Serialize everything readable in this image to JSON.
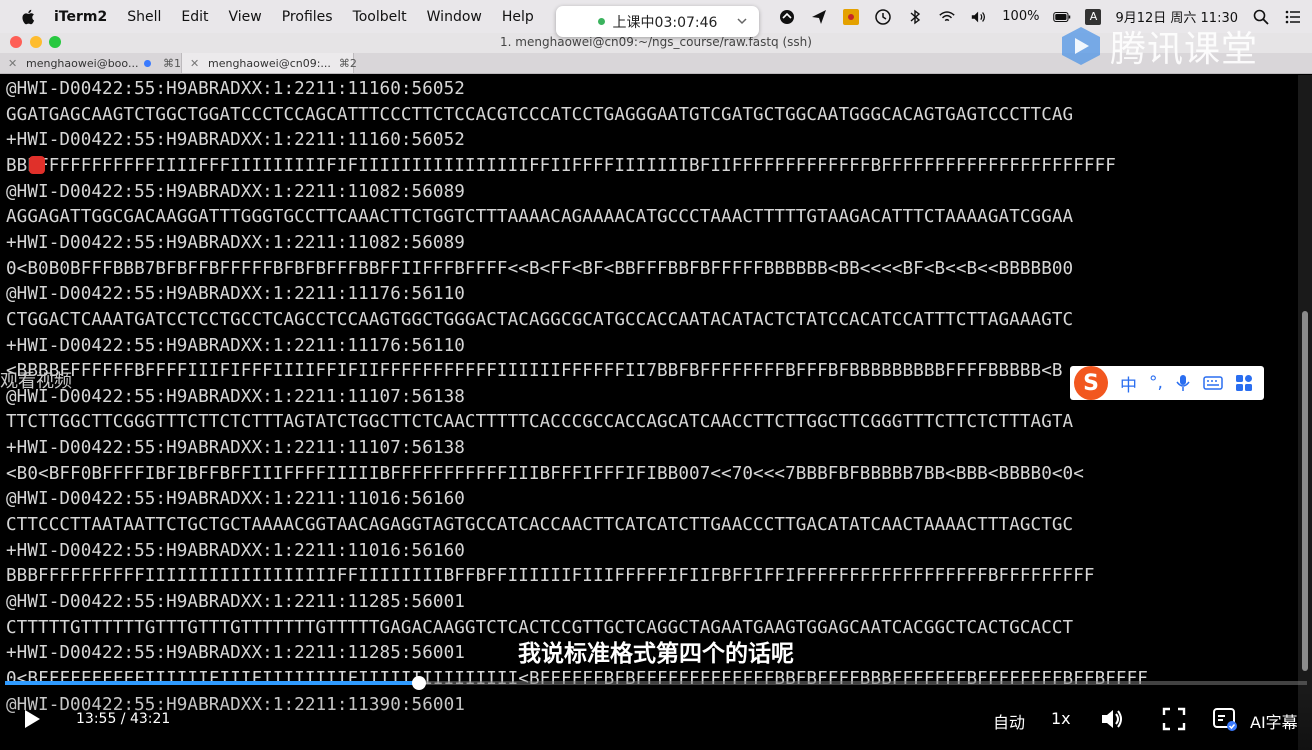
{
  "menubar": {
    "app_name": "iTerm2",
    "items": [
      "Shell",
      "Edit",
      "View",
      "Profiles",
      "Toolbelt",
      "Window",
      "Help"
    ],
    "battery": "100%",
    "input_source": "A",
    "datetime": "9月12日 周六  11:30"
  },
  "class_status": {
    "label": "上课中03:07:46",
    "dot_color": "#3bb35e"
  },
  "window": {
    "title": "1. menghaowei@cn09:~/ngs_course/raw.fastq (ssh)"
  },
  "tabs": [
    {
      "label": "menghaowei@boo...",
      "shortcut": "⌘1"
    },
    {
      "label": "menghaowei@cn09:...",
      "shortcut": "⌘2"
    }
  ],
  "watermark": {
    "text": "腾讯课堂"
  },
  "terminal_lines": [
    "@HWI-D00422:55:H9ABRADXX:1:2211:11160:56052",
    "GGATGAGCAAGTCTGGCTGGATCCCTCCAGCATTTCCCTTCTCCACGTCCCATCCTGAGGGAATGTCGATGCTGGCAATGGGCACAGTGAGTCCCTTCAG",
    "+HWI-D00422:55:H9ABRADXX:1:2211:11160:56052",
    "BBBFFFFFFFFFFFIIIIFFFIIIIIIIIIFIFIIIIIIIIIIIIIIIIFFIIFFFFIIIIIIIBFIIFFFFFFFFFFFFFBFFFFFFFFFFFFFFFFFFFFFF",
    "@HWI-D00422:55:H9ABRADXX:1:2211:11082:56089",
    "AGGAGATTGGCGACAAGGATTTGGGTGCCTTCAAACTTCTGGTCTTTAAAACAGAAAACATGCCCTAAACTTTTTGTAAGACATTTCTAAAAGATCGGAA",
    "+HWI-D00422:55:H9ABRADXX:1:2211:11082:56089",
    "0<B0B0BFFFBBB7BFBFFBFFFFFBFBFBFFFBBFFIIFFFBFFFF<<B<FF<BF<BBFFFBBFBFFFFFBBBBBB<BB<<<<BF<B<<B<<BBBBB00",
    "@HWI-D00422:55:H9ABRADXX:1:2211:11176:56110",
    "CTGGACTCAAATGATCCTCCTGCCTCAGCCTCCAAGTGGCTGGGACTACAGGCGCATGCCACCAATACATACTCTATCCACATCCATTTCTTAGAAAGTC",
    "+HWI-D00422:55:H9ABRADXX:1:2211:11176:56110",
    "<BBBBFFFFFFFBFFFFIIIFIFFFIIIIFFIFIIFFFFFFFFFFFIIIIIIFFFFFFII7BBFBFFFFFFFFBFFFBFBBBBBBBBBFFFFBBBBB<B",
    "@HWI-D00422:55:H9ABRADXX:1:2211:11107:56138",
    "TTCTTGGCTTCGGGTTTCTTCTCTTTAGTATCTGGCTTCTCAACTTTTTCACCCGCCACCAGCATCAACCTTCTTGGCTTCGGGTTTCTTCTCTTTAGTA",
    "+HWI-D00422:55:H9ABRADXX:1:2211:11107:56138",
    "<B0<BFF0BFFFFIBFIBFFBFFIIIFFFFIIIIIBFFFFFFFFFFFIIIBFFFIFFFIFIBB007<<70<<<7BBBFBFBBBBB7BB<BBB<BBBB0<0<",
    "@HWI-D00422:55:H9ABRADXX:1:2211:11016:56160",
    "CTTCCCTTAATAATTCTGCTGCTAAAACGGTAACAGAGGTAGTGCCATCACCAACTTCATCATCTTGAACCCTTGACATATCAACTAAAACTTTAGCTGC",
    "+HWI-D00422:55:H9ABRADXX:1:2211:11016:56160",
    "BBBFFFFFFFFFFIIIIIIIIIIIIIIIIIIFFIIIIIIIIBFFBFFIIIIIIFIIIFFFFFIFIIFBFFIFFIFFFFFFFFFFFFFFFFFFBFFFFFFFFF",
    "@HWI-D00422:55:H9ABRADXX:1:2211:11285:56001",
    "CTTTTTGTTTTTTGTTTGTTTGTTTTTTTGTTTTTGAGACAAGGTCTCACTCCGTTGCTCAGGCTAGAATGAAGTGGAGCAATCACGGCTCACTGCACCT",
    "+HWI-D00422:55:H9ABRADXX:1:2211:11285:56001",
    "0<BFFFFFFFFFFIIIIIIFIIIFIIIIIIIIFIIIIIIIIIIIIIII<BFFFFFFBFBFFFFFFFFFFFFFBBFBFFFFBBBFFFFFFFBFFFFFFFFBFFBFFFF",
    "@HWI-D00422:55:H9ABRADXX:1:2211:11390:56001"
  ],
  "side_text": "观看视频",
  "ime": {
    "logo_letter": "S",
    "lang": "中",
    "punct": "°,"
  },
  "subtitle": "我说标准格式第四个的话呢",
  "player": {
    "progress": 0.318,
    "current_time": "13:55",
    "duration": "43:21",
    "time_display": "13:55 / 43:21",
    "quality": "自动",
    "speed": "1x",
    "ai_caption": "AI字幕"
  },
  "colors": {
    "progress_fill": "#2f9bff",
    "ime_orange": "#f2571f",
    "terminal_text": "#d6d6d6"
  }
}
